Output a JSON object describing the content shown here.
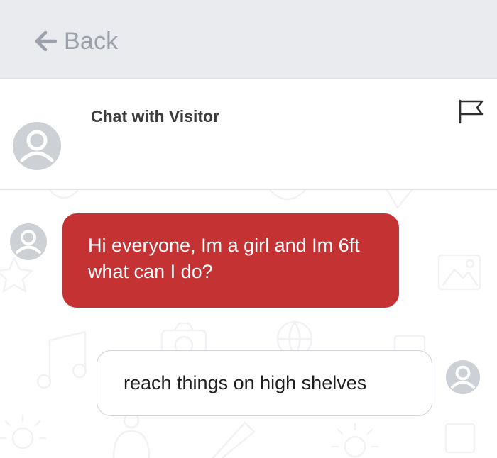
{
  "topbar": {
    "back_label": "Back",
    "back_icon": "arrow-left-icon"
  },
  "header": {
    "title": "Chat with Visitor",
    "avatar_icon": "user-avatar-icon",
    "flag_icon": "flag-icon"
  },
  "messages": [
    {
      "sender": "visitor",
      "text": "Hi everyone, Im a girl and Im 6ft what can I do?",
      "bubble_color": "#c53234",
      "text_color": "#ffffff"
    },
    {
      "sender": "agent",
      "text": "reach things on high shelves",
      "bubble_color": "#ffffff",
      "text_color": "#1f1f1f"
    }
  ],
  "colors": {
    "topbar_bg": "#e9ebee",
    "back_text": "#9aa1aa",
    "avatar_gray": "#cdd1d6",
    "accent_red": "#c53234"
  }
}
